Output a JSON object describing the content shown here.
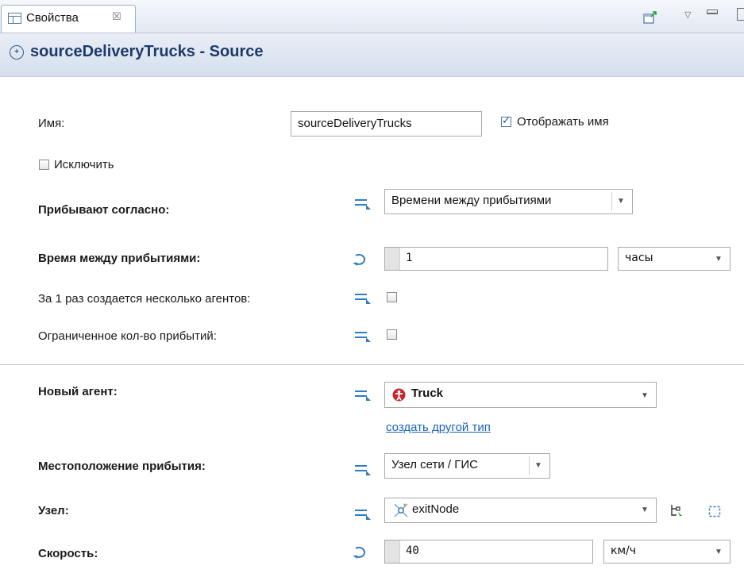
{
  "tab": {
    "label": "Свойства",
    "close_glyph": "☒"
  },
  "header": {
    "title": "sourceDeliveryTrucks - Source",
    "icon": "source-block-icon"
  },
  "name_row": {
    "label": "Имя:",
    "value": "sourceDeliveryTrucks",
    "show_name_label": "Отображать имя",
    "show_name_checked": true
  },
  "exclude": {
    "label": "Исключить",
    "checked": false
  },
  "arrivals": {
    "label": "Прибывают согласно:",
    "value": "Времени между прибытиями"
  },
  "interarrival": {
    "label": "Время между прибытиями:",
    "value": "1",
    "unit": "часы"
  },
  "multiple_agents": {
    "label": "За 1 раз создается несколько агентов:",
    "checked": false
  },
  "limited_arrivals": {
    "label": "Ограниченное кол-во прибытий:",
    "checked": false
  },
  "new_agent": {
    "label": "Новый агент:",
    "value": "Truck",
    "link": "создать другой тип"
  },
  "arrival_location": {
    "label": "Местоположение прибытия:",
    "value": "Узел сети / ГИС"
  },
  "node": {
    "label": "Узел:",
    "value": "exitNode"
  },
  "speed": {
    "label": "Скорость:",
    "value": "40",
    "unit": "км/ч"
  },
  "colors": {
    "title": "#1e3a6b",
    "link": "#1a62b8",
    "accent": "#2f7dc2",
    "error_icon": "#c9252b"
  }
}
